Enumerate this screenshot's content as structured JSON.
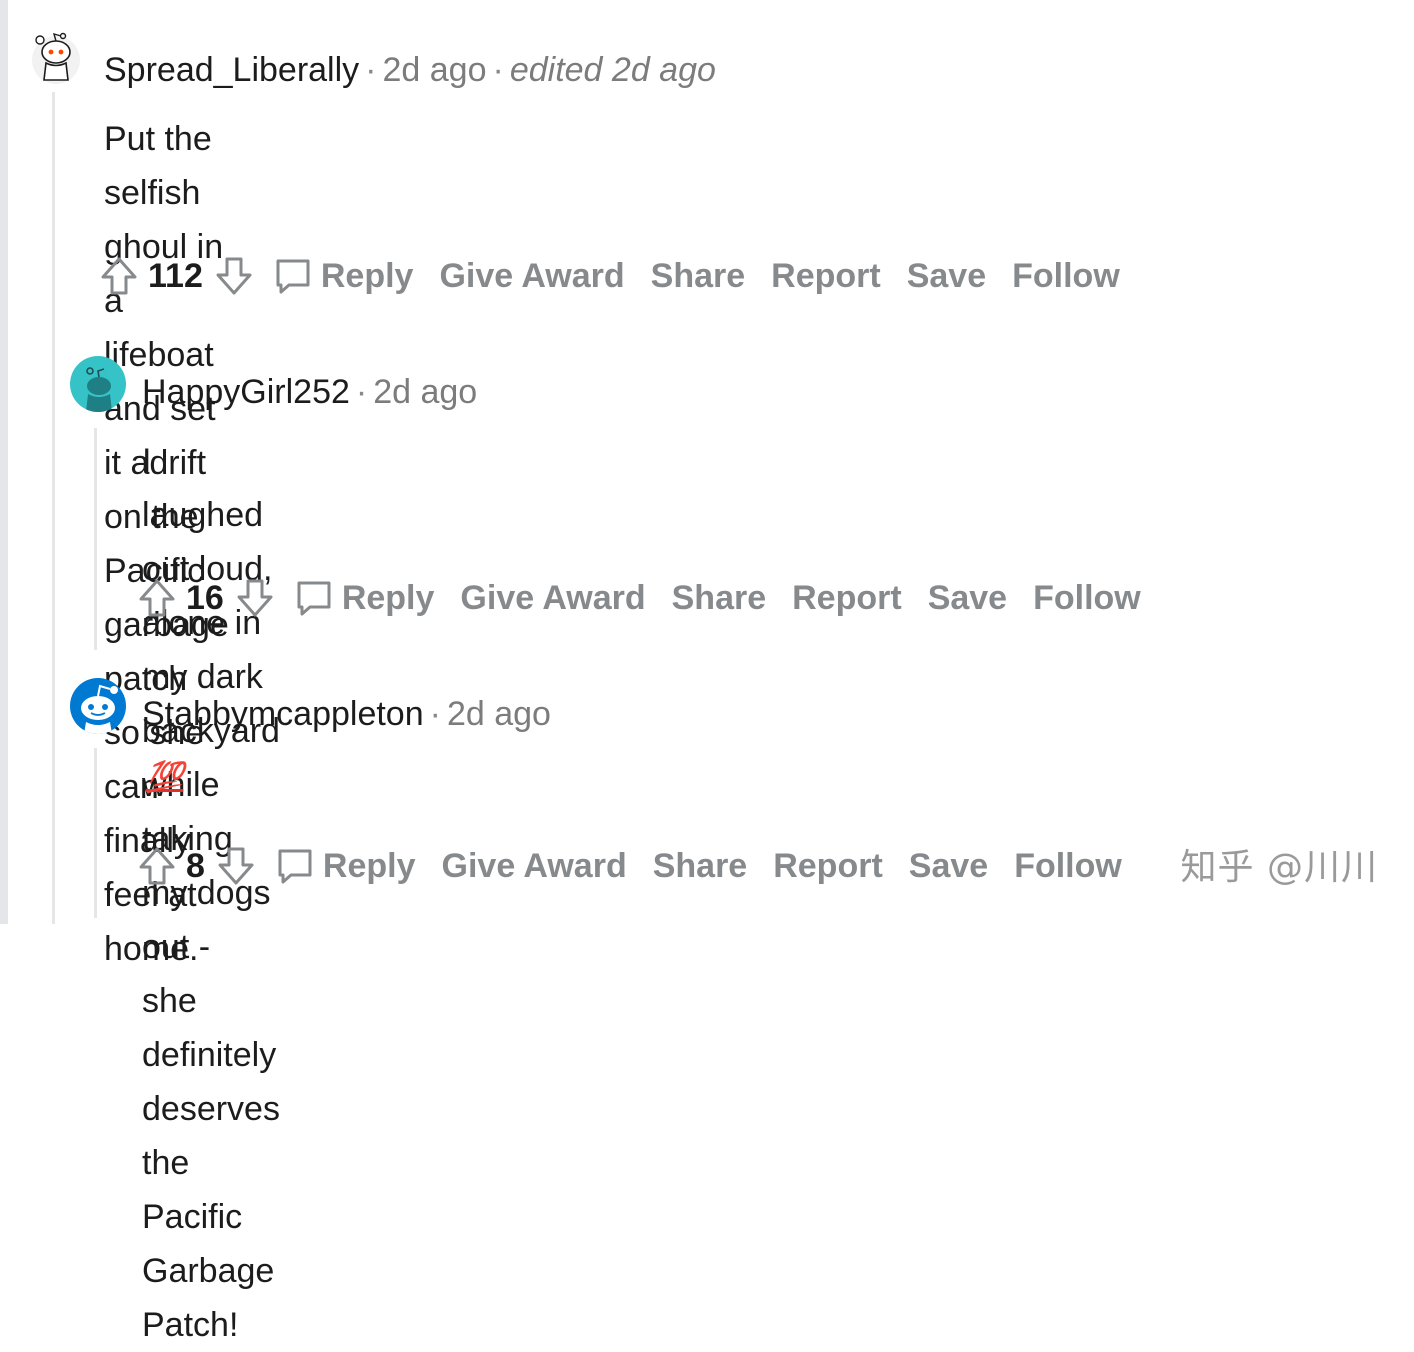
{
  "comments": [
    {
      "username": "Spread_Liberally",
      "time": "2d ago",
      "edited": "edited 2d ago",
      "body_lines": [
        "Put the selfish ghoul in a lifeboat and set it adrift on the Pacific garbage",
        "patch so she can finally feel at home."
      ],
      "score": "112"
    },
    {
      "username": "HappyGirl252",
      "time": "2d ago",
      "body_lines": [
        "I laughed out loud, alone in my dark backyard while taking my dogs out -",
        "she definitely deserves the Pacific Garbage Patch!"
      ],
      "score": "16"
    },
    {
      "username": "Stabbymcappleton",
      "time": "2d ago",
      "body": "💯",
      "score": "8"
    }
  ],
  "actions": {
    "reply": "Reply",
    "give_award": "Give Award",
    "share": "Share",
    "report": "Report",
    "save": "Save",
    "follow": "Follow"
  },
  "separator": "·",
  "watermark": "知乎 @川川",
  "colors": {
    "text": "#1c1c1c",
    "muted": "#878a8c",
    "thread_line": "#e6e6e6",
    "avatar_teal": "#36c3c8",
    "avatar_blue": "#0079d3",
    "snoo_orange": "#ff4500"
  }
}
